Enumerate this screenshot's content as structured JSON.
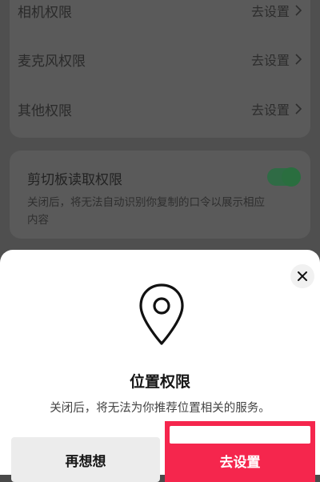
{
  "settings": {
    "rows": [
      {
        "label": "相机权限",
        "action": "去设置"
      },
      {
        "label": "麦克风权限",
        "action": "去设置"
      },
      {
        "label": "其他权限",
        "action": "去设置"
      }
    ],
    "clipboard": {
      "title": "剪切板读取权限",
      "description": "关闭后，将无法自动识别你复制的口令以展示相应内容",
      "enabled": true
    }
  },
  "dialog": {
    "icon": "location-pin-icon",
    "title": "位置权限",
    "description": "关闭后，将无法为你推荐位置相关的服务。",
    "cancel_label": "再想想",
    "confirm_label": "去设置"
  },
  "colors": {
    "confirm": "#f5264d",
    "toggle_on": "#2f6b45"
  }
}
